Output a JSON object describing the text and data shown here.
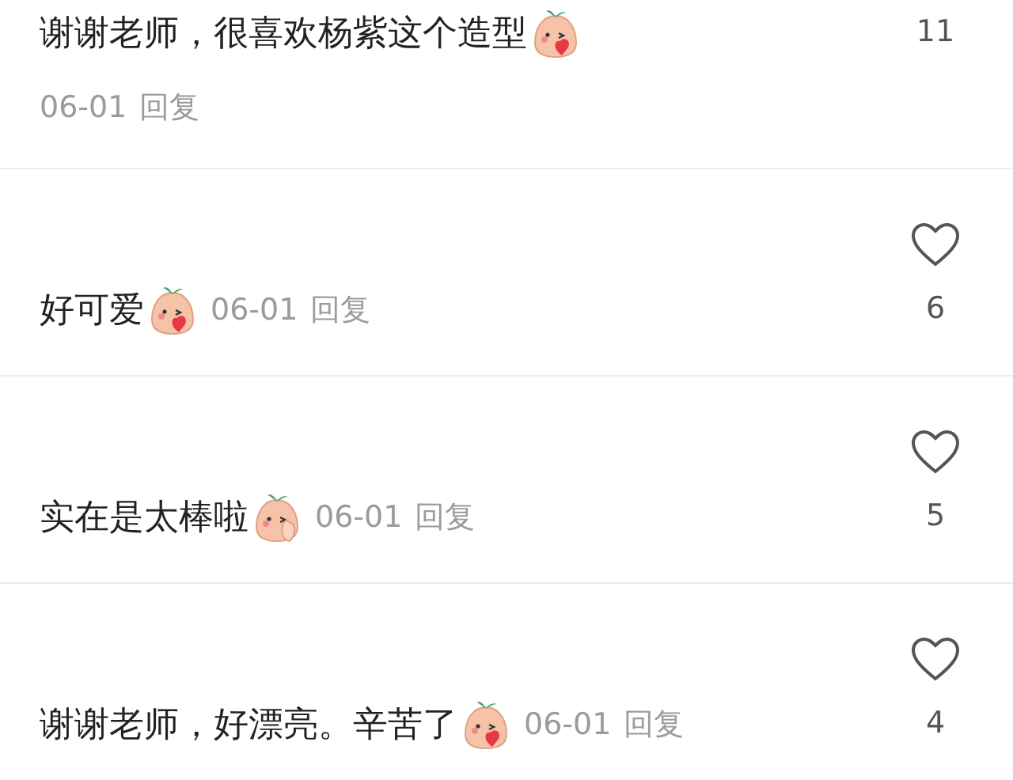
{
  "comments": [
    {
      "text": "谢谢老师，很喜欢杨紫这个造型",
      "emoji": {
        "kind": "kiss"
      },
      "date": "06-01",
      "reply": "回复",
      "likes": "11",
      "heart_visible": false,
      "date_inline": false
    },
    {
      "text": "好可爱",
      "emoji": {
        "kind": "kiss"
      },
      "date": "06-01",
      "reply": "回复",
      "likes": "6",
      "heart_visible": true,
      "date_inline": true
    },
    {
      "text": "实在是太棒啦",
      "emoji": {
        "kind": "hand"
      },
      "date": "06-01",
      "reply": "回复",
      "likes": "5",
      "heart_visible": true,
      "date_inline": true
    },
    {
      "text": "谢谢老师，好漂亮。辛苦了",
      "emoji": {
        "kind": "kiss"
      },
      "date": "06-01",
      "reply": "回复",
      "likes": "4",
      "heart_visible": true,
      "date_inline": true
    }
  ]
}
